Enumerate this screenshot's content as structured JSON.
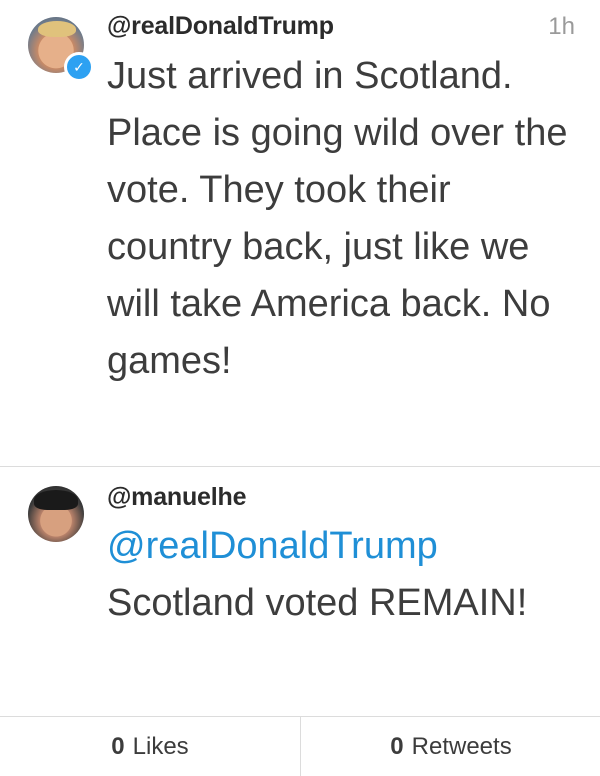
{
  "tweet": {
    "handle": "@realDonaldTrump",
    "time": "1h",
    "text": "Just arrived in Scotland. Place is going wild over the vote. They took their country back, just like we will take America back. No games!",
    "verified_icon": "verified-check-icon"
  },
  "reply": {
    "handle": "@manuelhe",
    "mention": "@realDonaldTrump",
    "text": "Scotland voted REMAIN!"
  },
  "stats": {
    "likes_count": "0",
    "likes_label": "Likes",
    "retweets_count": "0",
    "retweets_label": "Retweets"
  },
  "colors": {
    "mention": "#1f8fd6",
    "verified_badge": "#2da1f2",
    "text": "#3d3d3d",
    "muted": "#9a9a9a"
  }
}
